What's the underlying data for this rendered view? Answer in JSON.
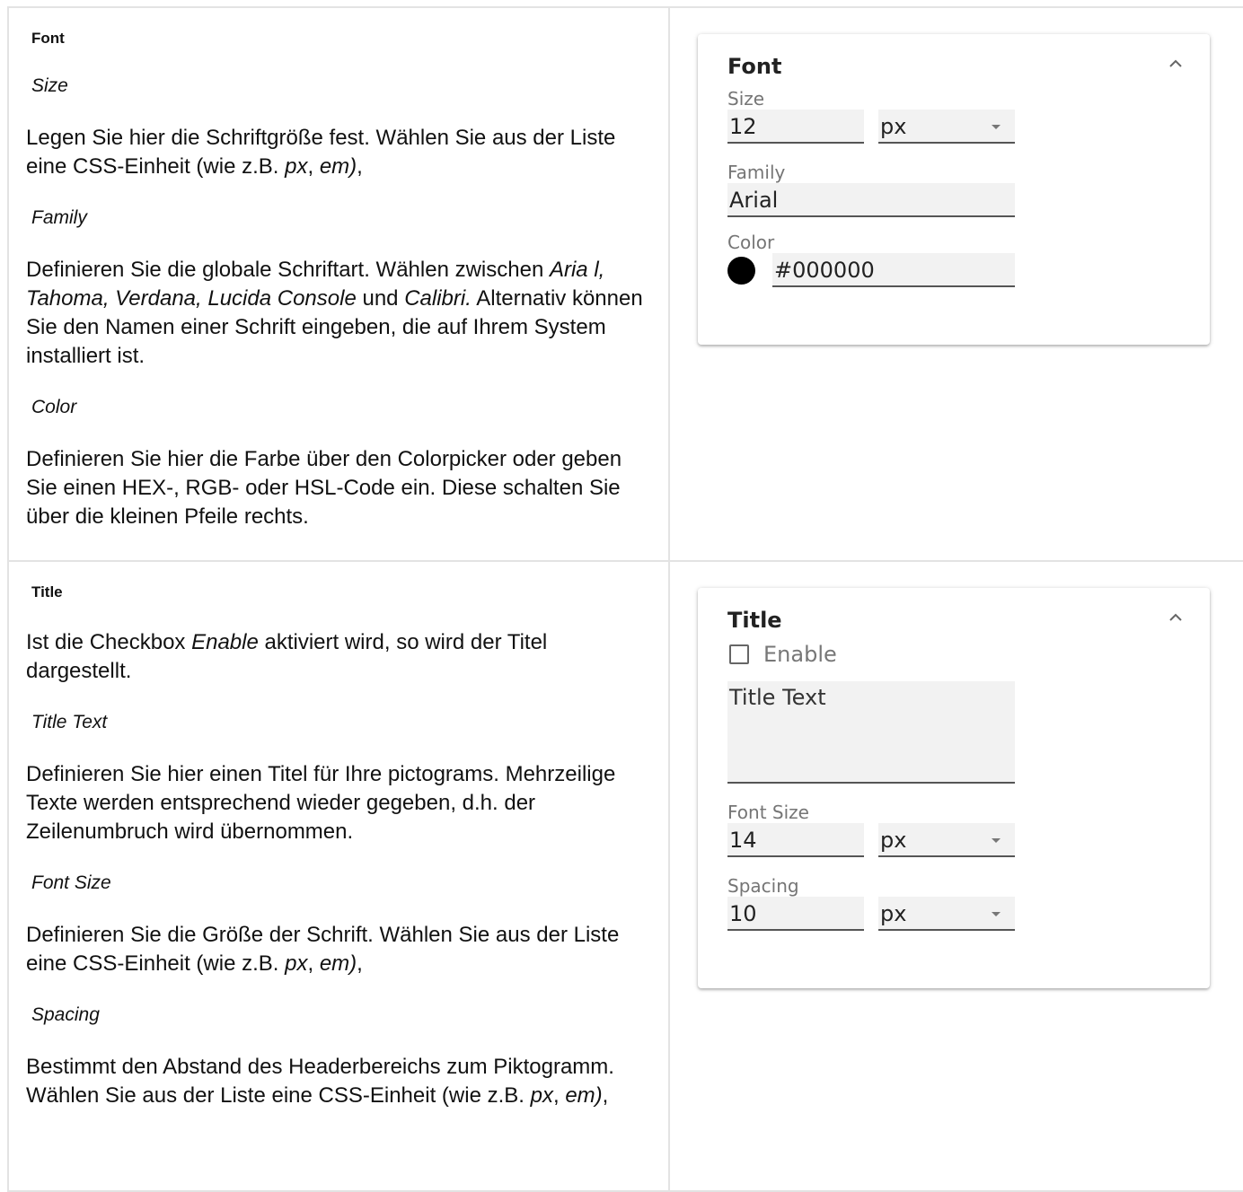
{
  "font_section": {
    "heading": "Font",
    "size_label": "Size",
    "size_desc_1": "Legen Sie hier die Schriftgröße fest. Wählen Sie aus der Liste eine CSS-Einheit (wie z.B. ",
    "size_desc_px": "px",
    "size_desc_sep": ", ",
    "size_desc_em": "em)",
    "size_desc_end": ",",
    "family_label": "Family",
    "family_desc_1": "Definieren Sie die globale Schriftart. Wählen zwischen ",
    "family_desc_fonts": "Aria l, Tahoma, Verdana, Lucida Console",
    "family_desc_und": " und ",
    "family_desc_calibri": "Calibri.",
    "family_desc_2": " Alternativ können Sie den Namen einer Schrift eingeben, die auf Ihrem System installiert ist.",
    "color_label": "Color",
    "color_desc": "Definieren Sie hier die Farbe über den Colorpicker oder geben Sie einen HEX-, RGB- oder HSL-Code ein. Diese schalten Sie über die kleinen Pfeile rechts."
  },
  "font_card": {
    "title": "Font",
    "size_label": "Size",
    "size_value": "12",
    "size_unit": "px",
    "family_label": "Family",
    "family_value": "Arial",
    "color_label": "Color",
    "color_value": "#000000",
    "color_swatch": "#000000"
  },
  "title_section": {
    "heading": "Title",
    "enable_desc_1": "Ist die Checkbox ",
    "enable_desc_em": "Enable",
    "enable_desc_2": " aktiviert wird, so wird der Titel dargestellt.",
    "title_text_label": "Title Text",
    "title_text_desc": "Definieren Sie hier einen Titel für Ihre pictograms. Mehrzeilige Texte werden entsprechend wieder gegeben, d.h. der Zeilenumbruch wird übernommen.",
    "font_size_label": "Font Size",
    "font_size_desc_1": "Definieren Sie die Größe der Schrift. Wählen Sie aus der Liste eine CSS-Einheit (wie z.B. ",
    "font_size_desc_px": "px",
    "font_size_desc_sep": ", ",
    "font_size_desc_em": "em)",
    "font_size_desc_end": ",",
    "spacing_label": "Spacing",
    "spacing_desc_1": "Bestimmt den Abstand des Headerbereichs zum Piktogramm. Wählen Sie aus der Liste eine CSS-Einheit (wie z.B. ",
    "spacing_desc_px": "px",
    "spacing_desc_sep": ", ",
    "spacing_desc_em": "em)",
    "spacing_desc_end": ","
  },
  "title_card": {
    "title": "Title",
    "enable_label": "Enable",
    "enable_checked": false,
    "title_text_placeholder": "Title Text",
    "font_size_label": "Font Size",
    "font_size_value": "14",
    "font_size_unit": "px",
    "spacing_label": "Spacing",
    "spacing_value": "10",
    "spacing_unit": "px"
  }
}
